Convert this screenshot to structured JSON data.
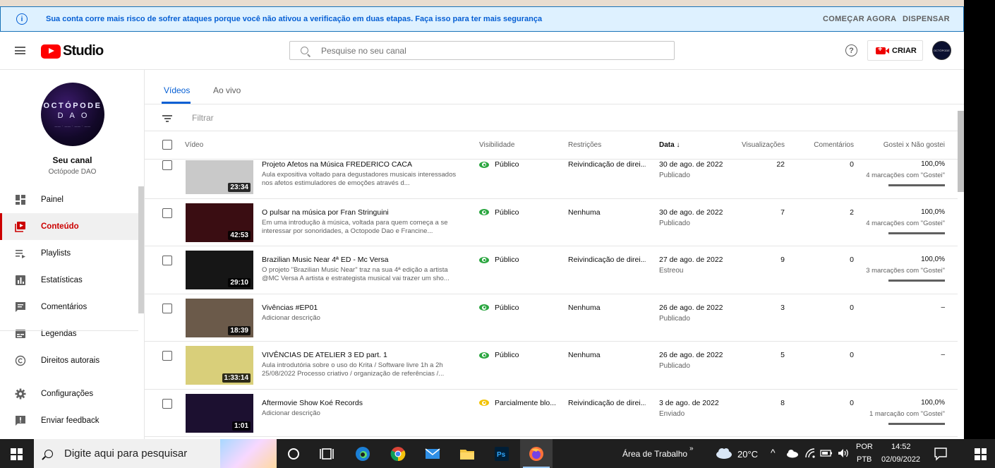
{
  "banner": {
    "message": "Sua conta corre mais risco de sofrer ataques porque você não ativou a verificação em duas etapas. Faça isso para ter mais segurança",
    "start_label": "COMEÇAR AGORA",
    "dismiss_label": "DISPENSAR"
  },
  "header": {
    "logo_text": "Studio",
    "search_placeholder": "Pesquise no seu canal",
    "create_label": "CRIAR"
  },
  "channel": {
    "avatar_line1": "OCTÓPODE",
    "avatar_line2": "DAO",
    "your_channel": "Seu canal",
    "name": "Octópode DAO"
  },
  "sidebar": {
    "items": [
      {
        "label": "Painel",
        "icon": "dashboard-icon",
        "active": false
      },
      {
        "label": "Conteúdo",
        "icon": "content-icon",
        "active": true
      },
      {
        "label": "Playlists",
        "icon": "playlists-icon",
        "active": false
      },
      {
        "label": "Estatísticas",
        "icon": "analytics-icon",
        "active": false
      },
      {
        "label": "Comentários",
        "icon": "comments-icon",
        "active": false
      },
      {
        "label": "Legendas",
        "icon": "subtitles-icon",
        "active": false
      },
      {
        "label": "Direitos autorais",
        "icon": "copyright-icon",
        "active": false
      }
    ],
    "bottom_items": [
      {
        "label": "Configurações",
        "icon": "gear-icon"
      },
      {
        "label": "Enviar feedback",
        "icon": "feedback-icon"
      }
    ]
  },
  "tabs": [
    {
      "label": "Vídeos",
      "active": true
    },
    {
      "label": "Ao vivo",
      "active": false
    }
  ],
  "filter": {
    "placeholder": "Filtrar"
  },
  "table": {
    "headers": {
      "video": "Vídeo",
      "visibility": "Visibilidade",
      "restrictions": "Restrições",
      "date": "Data",
      "views": "Visualizações",
      "comments": "Comentários",
      "likes": "Gostei x Não gostei"
    },
    "rows": [
      {
        "title": "Projeto Afetos na Música FREDERICO CACA",
        "description": "Aula expositiva voltado para degustadores musicais interessados nos afetos estimuladores de emoções através d...",
        "duration": "23:34",
        "visibility": "Público",
        "partial": false,
        "restriction": "Reivindicação de direi...",
        "date": "30 de ago. de 2022",
        "status": "Publicado",
        "views": "22",
        "comments": "0",
        "likes": "100,0%",
        "likes_sub": "4 marcações com \"Gostei\"",
        "thumb_bg": "#c9c9c9"
      },
      {
        "title": "O pulsar na música por Fran Stringuini",
        "description": "Em uma introdução à música, voltada para quem começa a se interessar por sonoridades, a Octopode Dao e Francine...",
        "duration": "42:53",
        "visibility": "Público",
        "partial": false,
        "restriction": "Nenhuma",
        "date": "30 de ago. de 2022",
        "status": "Publicado",
        "views": "7",
        "comments": "2",
        "likes": "100,0%",
        "likes_sub": "4 marcações com \"Gostei\"",
        "thumb_bg": "#3a0d12"
      },
      {
        "title": "Brazilian Music Near 4ª ED - Mc Versa",
        "description": "O projeto \"Brazilian Music Near\" traz na sua 4ª edição a artista @MC Versa A artista e estrategista musical vai trazer um sho...",
        "duration": "29:10",
        "visibility": "Público",
        "partial": false,
        "restriction": "Reivindicação de direi...",
        "date": "27 de ago. de 2022",
        "status": "Estreou",
        "views": "9",
        "comments": "0",
        "likes": "100,0%",
        "likes_sub": "3 marcações com \"Gostei\"",
        "thumb_bg": "#161616"
      },
      {
        "title": "Vivências #EP01",
        "description": "Adicionar descrição",
        "duration": "18:39",
        "visibility": "Público",
        "partial": false,
        "restriction": "Nenhuma",
        "date": "26 de ago. de 2022",
        "status": "Publicado",
        "views": "3",
        "comments": "0",
        "likes": "–",
        "likes_sub": "",
        "thumb_bg": "#6b5a4a"
      },
      {
        "title": "VIVÊNCIAS DE ATELIER 3 ED part. 1",
        "description": "Aula introdutória sobre o uso do Krita / Software livre 1h a 2h 25/08/2022 Processo criativo / organização de referências /...",
        "duration": "1:33:14",
        "visibility": "Público",
        "partial": false,
        "restriction": "Nenhuma",
        "date": "26 de ago. de 2022",
        "status": "Publicado",
        "views": "5",
        "comments": "0",
        "likes": "–",
        "likes_sub": "",
        "thumb_bg": "#d9cf7a"
      },
      {
        "title": "Aftermovie Show Koé Records",
        "description": "Adicionar descrição",
        "duration": "1:01",
        "visibility": "Parcialmente blo...",
        "partial": true,
        "restriction": "Reivindicação de direi...",
        "date": "3 de ago. de 2022",
        "status": "Enviado",
        "views": "8",
        "comments": "0",
        "likes": "100,0%",
        "likes_sub": "1 marcação com \"Gostei\"",
        "thumb_bg": "#1c1030"
      }
    ]
  },
  "taskbar": {
    "search_placeholder": "Digite aqui para pesquisar",
    "desktop_label": "Área de Trabalho",
    "temperature": "20°C",
    "lang1": "POR",
    "lang2": "PTB",
    "time": "14:52",
    "date": "02/09/2022"
  },
  "colors": {
    "accent_blue": "#065fd4",
    "brand_red": "#ff0000",
    "active_red": "#cc0000",
    "public_green": "#2ba640",
    "partial_yellow": "#f2c200"
  }
}
